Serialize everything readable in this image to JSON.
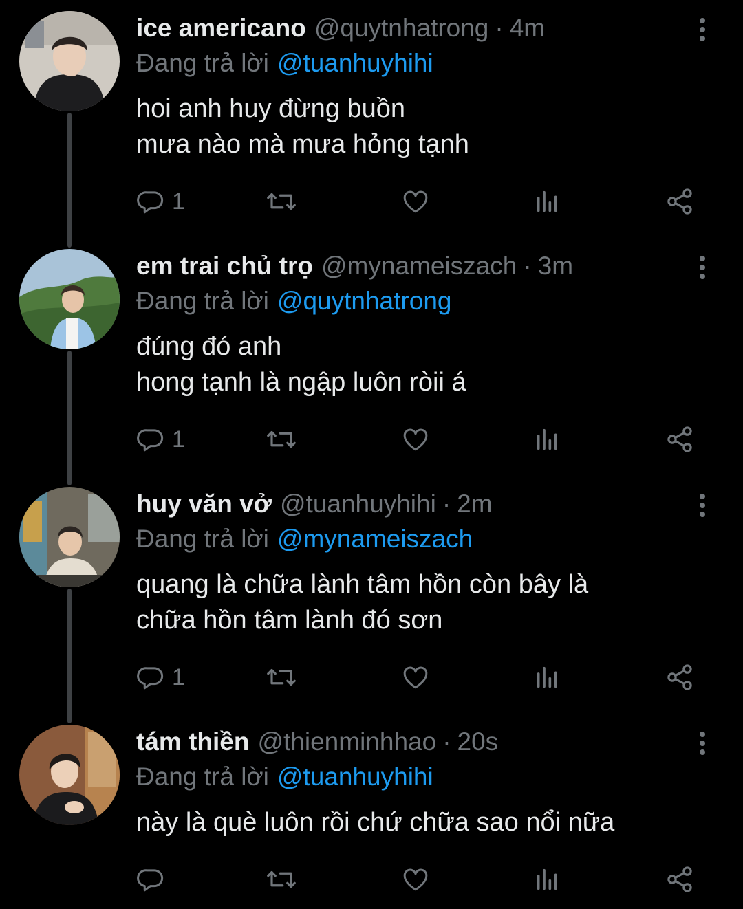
{
  "theme": {
    "background": "#000000",
    "text": "#e7e9ea",
    "muted": "#71767b",
    "accent": "#1d9bf0",
    "thread_line": "#3e4144"
  },
  "tweets": [
    {
      "display_name": "ice americano",
      "handle": "@quytnhatrong",
      "separator": "·",
      "time": "4m",
      "replying_to_label": "Đang trả lời",
      "replying_to_handle": "@tuanhuyhihi",
      "text_lines": [
        "hoi anh huy đừng buồn",
        "mưa nào mà mưa hỏng tạnh"
      ],
      "reply_count": "1",
      "avatar_icon": "user-avatar"
    },
    {
      "display_name": "em trai chủ trọ",
      "handle": "@mynameiszach",
      "separator": "·",
      "time": "3m",
      "replying_to_label": "Đang trả lời",
      "replying_to_handle": "@quytnhatrong",
      "text_lines": [
        "đúng đó anh",
        "hong tạnh là ngập luôn ròii á"
      ],
      "reply_count": "1",
      "avatar_icon": "user-avatar"
    },
    {
      "display_name": "huy văn vở",
      "handle": "@tuanhuyhihi",
      "separator": "·",
      "time": "2m",
      "replying_to_label": "Đang trả lời",
      "replying_to_handle": "@mynameiszach",
      "text_lines": [
        "quang là chữa lành tâm hồn còn bây là",
        "chữa hồn tâm lành đó sơn"
      ],
      "reply_count": "1",
      "avatar_icon": "user-avatar"
    },
    {
      "display_name": "tám thiền",
      "handle": "@thienminhhao",
      "separator": "·",
      "time": "20s",
      "replying_to_label": "Đang trả lời",
      "replying_to_handle": "@tuanhuyhihi",
      "text_lines": [
        "này là què luôn rồi chứ chữa sao nổi nữa"
      ],
      "reply_count": "",
      "avatar_icon": "user-avatar"
    }
  ],
  "icons": {
    "reply": "reply-icon",
    "retweet": "retweet-icon",
    "like": "heart-icon",
    "views": "views-icon",
    "share": "share-icon",
    "more": "more-vertical-icon"
  }
}
